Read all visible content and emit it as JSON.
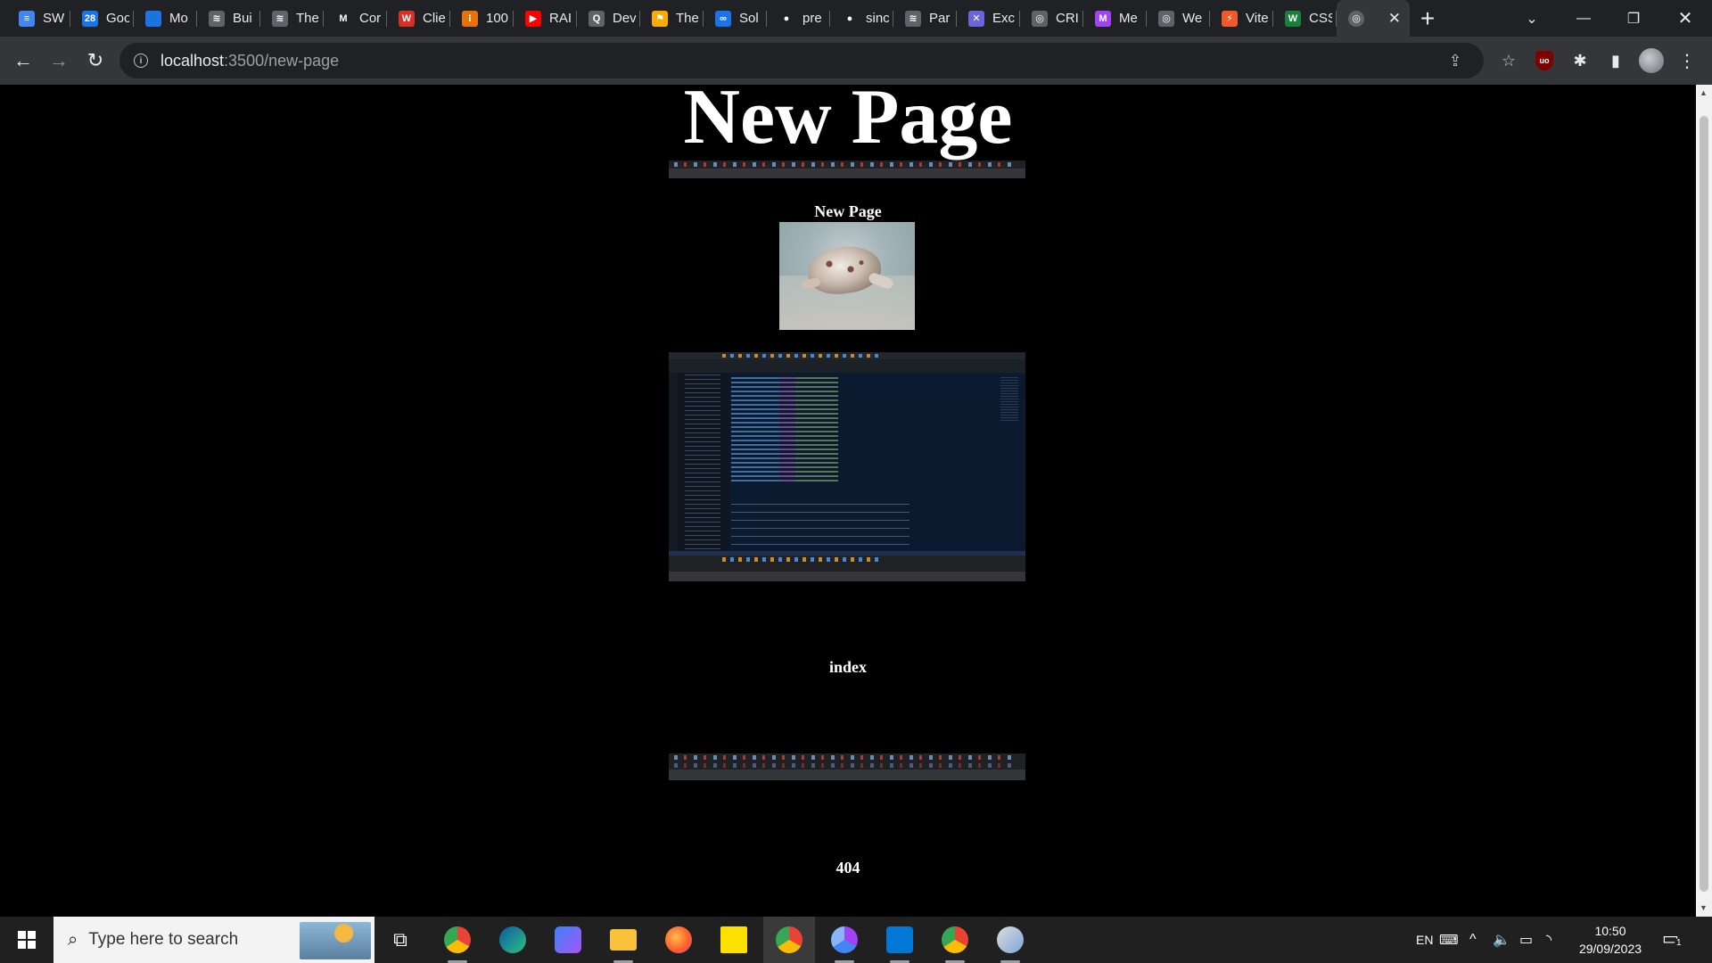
{
  "browser": {
    "tabs": [
      {
        "title": "SW",
        "icon": "docs-icon",
        "color": "#4285f4",
        "glyph": "≡"
      },
      {
        "title": "Goo",
        "icon": "calendar-icon",
        "color": "#1a73e8",
        "glyph": "28"
      },
      {
        "title": "Mo",
        "icon": "contacts-icon",
        "color": "#1a73e8",
        "glyph": "👤"
      },
      {
        "title": "Bui",
        "icon": "stack-icon",
        "color": "#5f6368",
        "glyph": "≋"
      },
      {
        "title": "The",
        "icon": "stack-icon",
        "color": "#5f6368",
        "glyph": "≋"
      },
      {
        "title": "Cor",
        "icon": "medium-icon",
        "color": "#202124",
        "glyph": "M"
      },
      {
        "title": "Clie",
        "icon": "w-red-icon",
        "color": "#d93025",
        "glyph": "W"
      },
      {
        "title": "100",
        "icon": "dev-orange-icon",
        "color": "#e8710a",
        "glyph": "⁝"
      },
      {
        "title": "RAI",
        "icon": "youtube-icon",
        "color": "#ff0000",
        "glyph": "▶"
      },
      {
        "title": "Dev",
        "icon": "search-doc-icon",
        "color": "#5f6368",
        "glyph": "Q"
      },
      {
        "title": "The",
        "icon": "bookmark-yellow-icon",
        "color": "#f9ab00",
        "glyph": "⚑"
      },
      {
        "title": "Sol",
        "icon": "infinity-icon",
        "color": "#1a73e8",
        "glyph": "∞"
      },
      {
        "title": "pre",
        "icon": "github-icon",
        "color": "#202124",
        "glyph": "●"
      },
      {
        "title": "sinc",
        "icon": "github-icon",
        "color": "#202124",
        "glyph": "●"
      },
      {
        "title": "Par",
        "icon": "stack-icon",
        "color": "#5f6368",
        "glyph": "≋"
      },
      {
        "title": "Exc",
        "icon": "excalidraw-icon",
        "color": "#6965db",
        "glyph": "✕"
      },
      {
        "title": "CRI",
        "icon": "globe-icon",
        "color": "#5f6368",
        "glyph": "◎"
      },
      {
        "title": "Me",
        "icon": "make-icon",
        "color": "#a142f4",
        "glyph": "M"
      },
      {
        "title": "We",
        "icon": "globe-icon",
        "color": "#5f6368",
        "glyph": "◎"
      },
      {
        "title": "Vite",
        "icon": "vite-icon",
        "color": "#f05a28",
        "glyph": "⚡"
      },
      {
        "title": "CSS",
        "icon": "w-green-icon",
        "color": "#188038",
        "glyph": "W"
      }
    ],
    "active_tab": {
      "icon": "globe-icon"
    },
    "address": {
      "host": "localhost",
      "path": ":3500/new-page"
    }
  },
  "page": {
    "main_heading": "New Page",
    "subheading": "New Page",
    "index_label": "index",
    "not_found_label": "404",
    "photo_alt": "crab on sand"
  },
  "taskbar": {
    "search_placeholder": "Type here to search",
    "language": "EN",
    "time": "10:50",
    "date": "29/09/2023",
    "notification_count": "1"
  }
}
